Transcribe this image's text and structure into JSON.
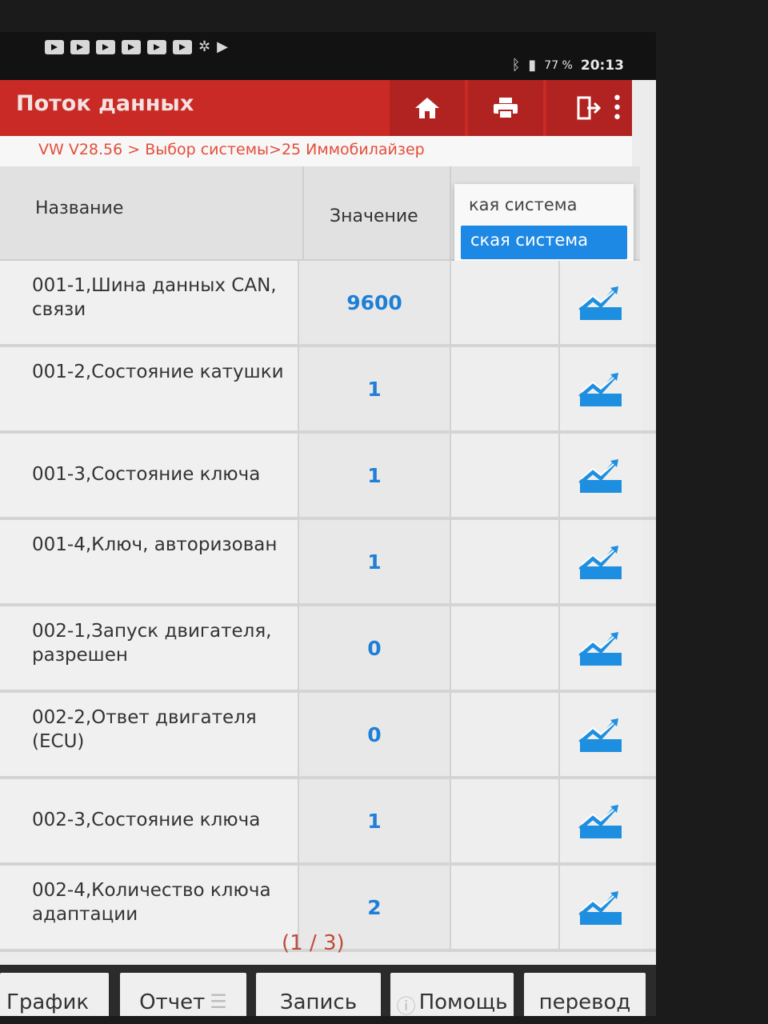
{
  "status_bar": {
    "battery": "77 %",
    "time": "20:13"
  },
  "header": {
    "title": "Поток данных",
    "icons": [
      "home-icon",
      "print-icon",
      "exit-icon",
      "more-vert-icon"
    ]
  },
  "breadcrumb": "VW V28.56 > Выбор системы>25 Иммобилайзер",
  "table": {
    "col_name": "Название",
    "col_value": "Значение",
    "dropdown": {
      "option1": "кая система",
      "option2_selected": "ская система"
    },
    "rows": [
      {
        "name": "001-1,Шина данных CAN, связи",
        "value": "9600"
      },
      {
        "name": "001-2,Состояние катушки",
        "value": "1"
      },
      {
        "name": "001-3,Состояние ключа",
        "value": "1"
      },
      {
        "name": "001-4,Ключ, авторизован",
        "value": "1"
      },
      {
        "name": "002-1,Запуск двигателя, разрешен",
        "value": "0"
      },
      {
        "name": "002-2,Ответ двигателя (ECU)",
        "value": "0"
      },
      {
        "name": "002-3,Состояние ключа",
        "value": "1"
      },
      {
        "name": "002-4,Количество ключа адаптации",
        "value": "2"
      }
    ]
  },
  "pager": "(1 / 3)",
  "toolbar": {
    "graph": "График",
    "report": "Отчет",
    "record": "Запись",
    "help": "Помощь",
    "translate": "перевод"
  },
  "colors": {
    "header_red": "#c92a25",
    "value_blue": "#1e7fd6",
    "selected_blue": "#1e88e5"
  }
}
